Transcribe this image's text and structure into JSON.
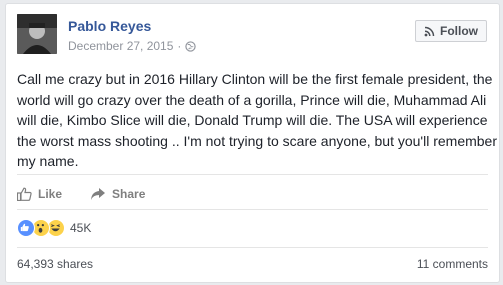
{
  "post": {
    "author": "Pablo Reyes",
    "date": "December 27, 2015",
    "separator": "·",
    "privacy_icon": "globe-icon",
    "follow_label": "Follow",
    "text": "Call me crazy but in 2016 Hillary Clinton will be the first female president, the world will go crazy over the death of a gorilla, Prince will die, Muhammad Ali will die, Kimbo Slice will die, Donald Trump will die. The USA will experience the worst mass shooting .. I'm not trying to scare anyone, but you'll remember my name."
  },
  "actions": {
    "like_label": "Like",
    "share_label": "Share"
  },
  "reactions": {
    "icons": [
      "like-icon",
      "wow-icon",
      "haha-icon"
    ],
    "count": "45K"
  },
  "footer": {
    "shares": "64,393 shares",
    "comments": "11 comments"
  },
  "colors": {
    "link": "#365899",
    "like_blue": "#5890ff",
    "reaction_yellow": "#fcd24b"
  }
}
